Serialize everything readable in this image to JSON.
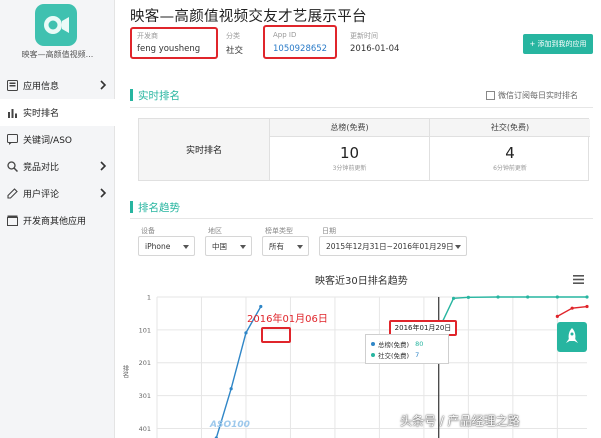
{
  "app": {
    "name": "映客—高颜值视频...",
    "icon": "camera-icon"
  },
  "sidebar": {
    "items": [
      {
        "label": "应用信息",
        "icon": "app-info-icon",
        "chevron": true
      },
      {
        "label": "实时排名",
        "icon": "bar-chart-icon",
        "chevron": false,
        "active": true
      },
      {
        "label": "关键词/ASO",
        "icon": "chat-icon",
        "chevron": false
      },
      {
        "label": "竞品对比",
        "icon": "search-icon",
        "chevron": true
      },
      {
        "label": "用户评论",
        "icon": "pen-icon",
        "chevron": true
      },
      {
        "label": "开发商其他应用",
        "icon": "box-icon",
        "chevron": false
      }
    ]
  },
  "header": {
    "title": "映客—高颜值视频交友才艺展示平台",
    "developer_label": "开发商",
    "developer": "feng yousheng",
    "category_label": "分类",
    "category": "社交",
    "appid_label": "App ID",
    "appid": "1050928652",
    "updated_label": "更新时间",
    "updated": "2016-01-04",
    "add_button": "+ 添加到我的应用"
  },
  "realtime": {
    "title": "实时排名",
    "subscribe": "微信订阅每日实时排名",
    "row_label": "实时排名",
    "cols": [
      {
        "header": "总榜(免费)",
        "rank": "10",
        "updated": "3分钟前更新"
      },
      {
        "header": "社交(免费)",
        "rank": "4",
        "updated": "6分钟前更新"
      }
    ]
  },
  "trend": {
    "title": "排名趋势",
    "filters": [
      {
        "label": "设备",
        "value": "iPhone"
      },
      {
        "label": "地区",
        "value": "中国"
      },
      {
        "label": "榜单类型",
        "value": "所有"
      },
      {
        "label": "日期",
        "value": "2015年12月31日~2016年01月29日"
      }
    ]
  },
  "chart_data": {
    "type": "line",
    "title": "映客近30日排名趋势",
    "ylabel": "排名",
    "yticks": [
      "1",
      "101",
      "201",
      "301",
      "401"
    ],
    "y_reversed": true,
    "ylim": [
      1,
      430
    ],
    "x_count": 30,
    "grid": true,
    "series": [
      {
        "name": "总榜(免费)",
        "color": "#2f86c7",
        "points": [
          [
            5,
            430
          ],
          [
            6,
            280
          ],
          [
            7,
            110
          ],
          [
            8,
            30
          ]
        ]
      },
      {
        "name": "社交(免费)",
        "color": "#27b5a0",
        "points": [
          [
            20,
            100
          ],
          [
            21,
            5
          ],
          [
            22,
            2
          ],
          [
            24,
            1
          ],
          [
            26,
            1
          ],
          [
            28,
            1
          ],
          [
            30,
            1
          ]
        ]
      },
      {
        "name": "",
        "color": "#e0252b",
        "points": [
          [
            28,
            60
          ],
          [
            29,
            35
          ],
          [
            30,
            30
          ]
        ]
      }
    ],
    "tooltip": {
      "date": "2016年01月20日",
      "rows": [
        {
          "name": "总榜(免费)",
          "value": "80"
        },
        {
          "name": "社交(免费)",
          "value": "7"
        }
      ]
    },
    "annotation": "2016年01月06日"
  },
  "watermark": "头条号 / 产品经理之路",
  "logo_watermark": "ASO100"
}
